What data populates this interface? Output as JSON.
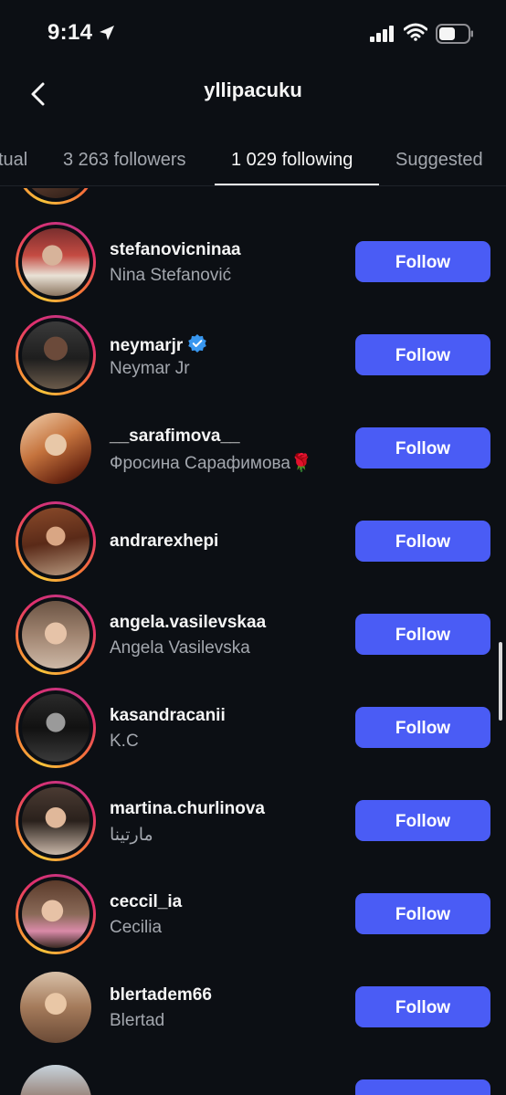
{
  "status": {
    "time": "9:14"
  },
  "header": {
    "title": "yllipacuku",
    "back_icon": "chevron-left-icon"
  },
  "tabs": [
    {
      "label": "tual"
    },
    {
      "label": "3 263 followers"
    },
    {
      "label": "1 029 following"
    },
    {
      "label": "Suggested"
    }
  ],
  "follow_label": "Follow",
  "rows": [
    {
      "username": "stefanovicninaa",
      "fullname": "Nina Stefanović",
      "verified": false
    },
    {
      "username": "neymarjr",
      "fullname": "Neymar Jr",
      "verified": true
    },
    {
      "username": "__sarafimova__",
      "fullname": "Фросина Сарафимова🌹",
      "verified": false
    },
    {
      "username": "andrarexhepi",
      "fullname": "",
      "verified": false
    },
    {
      "username": "angela.vasilevskaa",
      "fullname": "Angela Vasilevska",
      "verified": false
    },
    {
      "username": "kasandracanii",
      "fullname": "K.C",
      "verified": false
    },
    {
      "username": "martina.churlinova",
      "fullname": "مارتينا",
      "verified": false
    },
    {
      "username": "ceccil_ia",
      "fullname": "Cecilia",
      "verified": false
    },
    {
      "username": "blertadem66",
      "fullname": "Blertad",
      "verified": false
    }
  ],
  "colors": {
    "accent": "#4a5cf5",
    "background": "#0c0f14",
    "secondary_text": "#a3a7ae"
  }
}
